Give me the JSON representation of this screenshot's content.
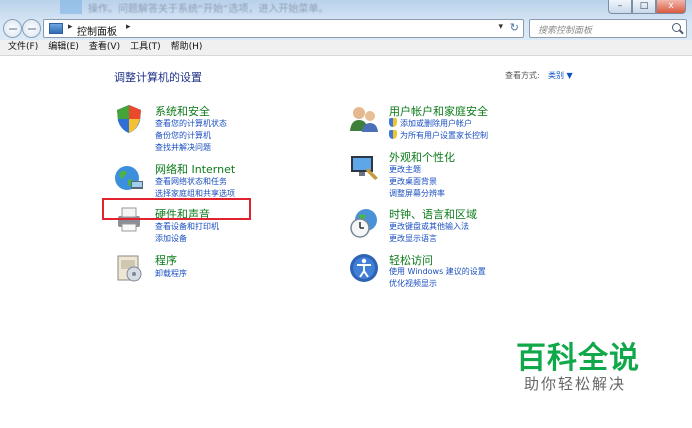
{
  "window": {
    "blurred_title": "操作。问题解答关于系统“开始”选项，进入开始菜单。",
    "minimize": "–",
    "maximize": "□",
    "close": "x"
  },
  "address_bar": {
    "location": "控制面板",
    "separator": "▸",
    "dropdown": "▾",
    "refresh": "↻"
  },
  "search": {
    "placeholder": "搜索控制面板"
  },
  "menu": [
    "文件(F)",
    "编辑(E)",
    "查看(V)",
    "工具(T)",
    "帮助(H)"
  ],
  "page": {
    "title": "调整计算机的设置",
    "view_by_label": "查看方式:",
    "view_by_value": "类别 ▼"
  },
  "categories_left": [
    {
      "title": "系统和安全",
      "links": [
        "查看您的计算机状态",
        "备份您的计算机",
        "查找并解决问题"
      ]
    },
    {
      "title": "网络和 Internet",
      "links": [
        "查看网络状态和任务",
        "选择家庭组和共享选项"
      ]
    },
    {
      "title": "硬件和声音",
      "links": [
        "查看设备和打印机",
        "添加设备"
      ]
    },
    {
      "title": "程序",
      "links": [
        "卸载程序"
      ]
    }
  ],
  "categories_right": [
    {
      "title": "用户帐户和家庭安全",
      "links": [
        "添加或删除用户帐户",
        "为所有用户设置家长控制"
      ]
    },
    {
      "title": "外观和个性化",
      "links": [
        "更改主题",
        "更改桌面背景",
        "调整屏幕分辨率"
      ]
    },
    {
      "title": "时钟、语言和区域",
      "links": [
        "更改键盘或其他输入法",
        "更改显示语言"
      ]
    },
    {
      "title": "轻松访问",
      "links": [
        "使用 Windows 建议的设置",
        "优化视频显示"
      ]
    }
  ],
  "colors": {
    "category_title": "#0b7a19",
    "link": "#1a4fc0",
    "highlight": "#e0232f",
    "watermark": "#10a84a"
  },
  "watermark": {
    "title": "百科全说",
    "subtitle": "助你轻松解决"
  }
}
